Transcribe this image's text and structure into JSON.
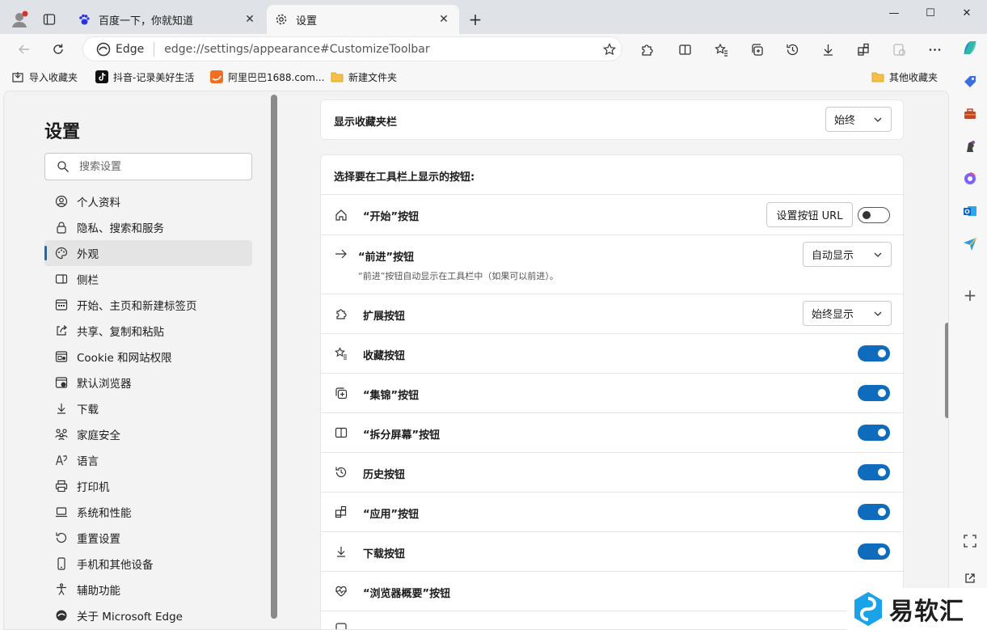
{
  "browser": {
    "tabs": [
      {
        "title": "百度一下，你就知道",
        "favicon": "baidu-paw-icon",
        "active": false
      },
      {
        "title": "设置",
        "favicon": "gear-icon",
        "active": true
      }
    ],
    "address": {
      "site_label": "Edge",
      "url": "edge://settings/appearance#CustomizeToolbar"
    }
  },
  "favorites_bar": {
    "items": [
      {
        "label": "导入收藏夹",
        "icon": "import-icon"
      },
      {
        "label": "抖音-记录美好生活",
        "icon": "douyin-icon"
      },
      {
        "label": "阿里巴巴1688.com...",
        "icon": "alibaba-icon"
      },
      {
        "label": "新建文件夹",
        "icon": "folder-icon"
      }
    ],
    "other": {
      "label": "其他收藏夹",
      "icon": "folder-icon"
    }
  },
  "sidebar": {
    "title": "设置",
    "search_placeholder": "搜索设置",
    "items": [
      {
        "label": "个人资料",
        "icon": "profile-icon"
      },
      {
        "label": "隐私、搜索和服务",
        "icon": "lock-icon"
      },
      {
        "label": "外观",
        "icon": "palette-icon",
        "active": true
      },
      {
        "label": "侧栏",
        "icon": "sidebar-icon"
      },
      {
        "label": "开始、主页和新建标签页",
        "icon": "home-grid-icon"
      },
      {
        "label": "共享、复制和粘贴",
        "icon": "share-icon"
      },
      {
        "label": "Cookie 和网站权限",
        "icon": "cookie-icon"
      },
      {
        "label": "默认浏览器",
        "icon": "browser-icon"
      },
      {
        "label": "下载",
        "icon": "download-icon"
      },
      {
        "label": "家庭安全",
        "icon": "family-icon"
      },
      {
        "label": "语言",
        "icon": "language-icon"
      },
      {
        "label": "打印机",
        "icon": "printer-icon"
      },
      {
        "label": "系统和性能",
        "icon": "laptop-icon"
      },
      {
        "label": "重置设置",
        "icon": "reset-icon"
      },
      {
        "label": "手机和其他设备",
        "icon": "phone-icon"
      },
      {
        "label": "辅助功能",
        "icon": "accessibility-icon"
      },
      {
        "label": "关于 Microsoft Edge",
        "icon": "edge-icon"
      }
    ]
  },
  "main": {
    "favorites_bar_setting": {
      "label": "显示收藏夹栏",
      "value": "始终"
    },
    "toolbar_section": {
      "heading": "选择要在工具栏上显示的按钮:",
      "rows": [
        {
          "label": "“开始”按钮",
          "icon": "home-icon",
          "button": "设置按钮 URL",
          "toggle": false
        },
        {
          "label": "“前进”按钮",
          "icon": "arrow-right-icon",
          "dropdown": "自动显示",
          "desc": "“前进”按钮自动显示在工具栏中（如果可以前进）。"
        },
        {
          "label": "扩展按钮",
          "icon": "puzzle-icon",
          "dropdown": "始终显示"
        },
        {
          "label": "收藏按钮",
          "icon": "favorites-icon",
          "toggle": true
        },
        {
          "label": "“集锦”按钮",
          "icon": "collections-icon",
          "toggle": true
        },
        {
          "label": "“拆分屏幕”按钮",
          "icon": "split-screen-icon",
          "toggle": true
        },
        {
          "label": "历史按钮",
          "icon": "history-icon",
          "toggle": true
        },
        {
          "label": "“应用”按钮",
          "icon": "apps-icon",
          "toggle": true
        },
        {
          "label": "下载按钮",
          "icon": "download-icon",
          "toggle": true
        },
        {
          "label": "“浏览器概要”按钮",
          "icon": "heartbeat-icon"
        }
      ]
    }
  },
  "watermark": {
    "text": "易软汇"
  },
  "colors": {
    "accent": "#0f6cbd",
    "titlebar": "#dfe3e8",
    "page_bg": "#f3f3f3"
  }
}
